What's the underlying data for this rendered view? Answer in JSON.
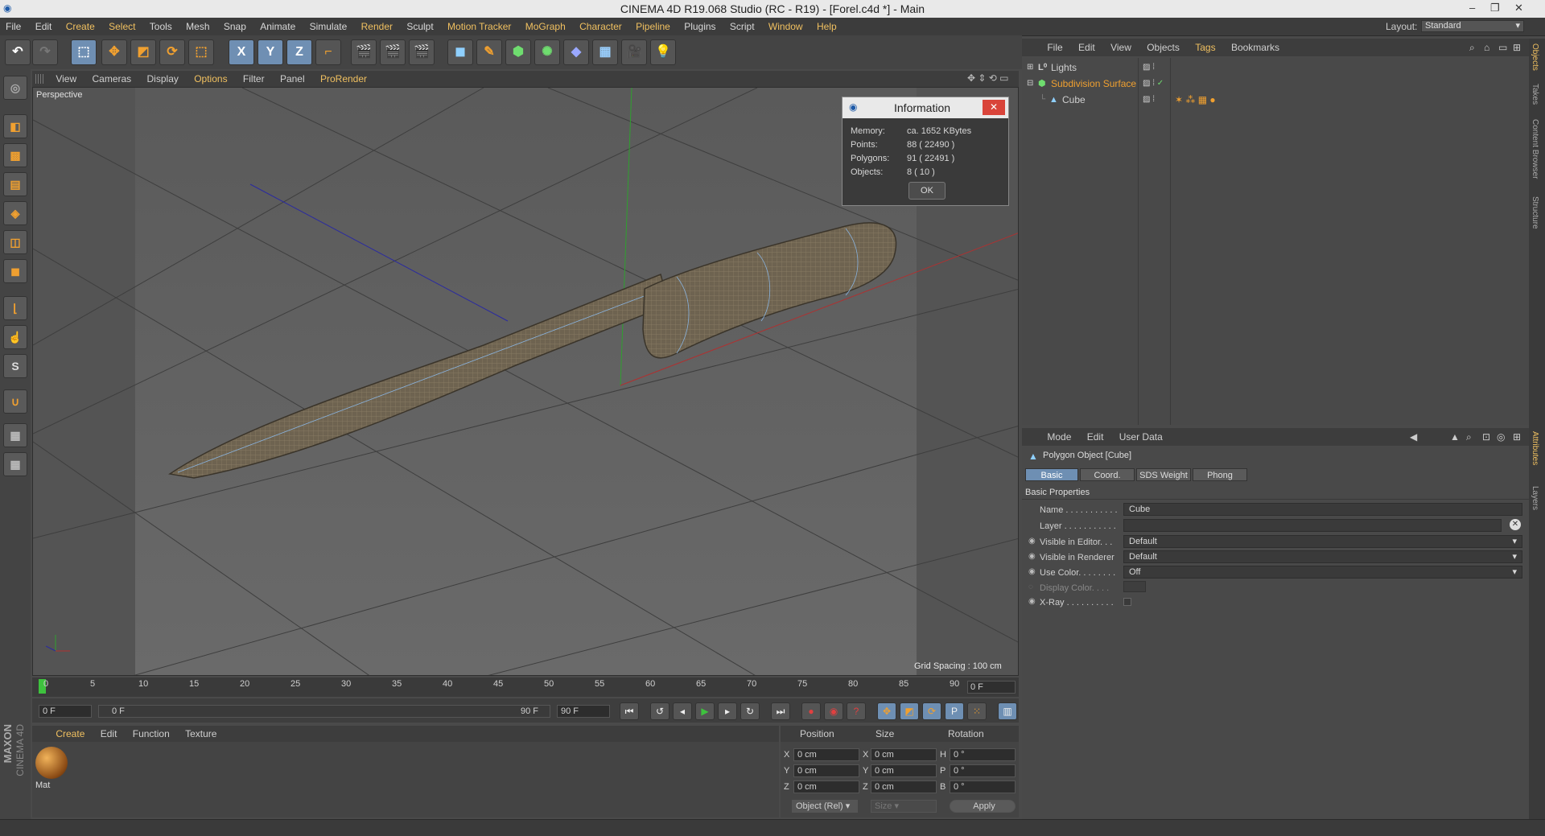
{
  "window": {
    "title": "CINEMA 4D R19.068 Studio (RC - R19) - [Forel.c4d *] - Main",
    "layout_label": "Layout:",
    "layout_value": "Standard"
  },
  "menubar": [
    "File",
    "Edit",
    "Create",
    "Select",
    "Tools",
    "Mesh",
    "Snap",
    "Animate",
    "Simulate",
    "Render",
    "Sculpt",
    "Motion Tracker",
    "MoGraph",
    "Character",
    "Pipeline",
    "Plugins",
    "Script",
    "Window",
    "Help"
  ],
  "toolbar": {
    "axis_x": "X",
    "axis_y": "Y",
    "axis_z": "Z"
  },
  "viewport": {
    "menu": [
      "View",
      "Cameras",
      "Display",
      "Options",
      "Filter",
      "Panel",
      "ProRender"
    ],
    "camera_label": "Perspective",
    "grid_spacing": "Grid Spacing : 100 cm"
  },
  "info_dialog": {
    "title": "Information",
    "rows": [
      {
        "label": "Memory:",
        "value": "ca. 1652 KBytes"
      },
      {
        "label": "Points:",
        "value": "88 ( 22490 )"
      },
      {
        "label": "Polygons:",
        "value": "91 ( 22491 )"
      },
      {
        "label": "Objects:",
        "value": "8 ( 10 )"
      }
    ],
    "ok_label": "OK"
  },
  "timeline": {
    "ticks": [
      "0",
      "5",
      "10",
      "15",
      "20",
      "25",
      "30",
      "35",
      "40",
      "45",
      "50",
      "55",
      "60",
      "65",
      "70",
      "75",
      "80",
      "85",
      "90"
    ],
    "current_frame": "0 F",
    "start_field": "0 F",
    "range_start": "0 F",
    "range_end": "90 F",
    "end_field": "90 F"
  },
  "material_manager": {
    "menu": [
      "Create",
      "Edit",
      "Function",
      "Texture"
    ],
    "materials": [
      {
        "name": "Mat"
      }
    ]
  },
  "coordinates": {
    "headers": {
      "position": "Position",
      "size": "Size",
      "rotation": "Rotation"
    },
    "rows": [
      {
        "axis": "X",
        "pos": "0 cm",
        "size_axis": "X",
        "size": "0 cm",
        "rot_axis": "H",
        "rot": "0 °"
      },
      {
        "axis": "Y",
        "pos": "0 cm",
        "size_axis": "Y",
        "size": "0 cm",
        "rot_axis": "P",
        "rot": "0 °"
      },
      {
        "axis": "Z",
        "pos": "0 cm",
        "size_axis": "Z",
        "size": "0 cm",
        "rot_axis": "B",
        "rot": "0 °"
      }
    ],
    "mode_select": "Object (Rel)",
    "size_select": "Size",
    "apply_label": "Apply"
  },
  "object_manager": {
    "menu": [
      "File",
      "Edit",
      "View",
      "Objects",
      "Tags",
      "Bookmarks"
    ],
    "objects": [
      {
        "name": "Lights",
        "color": "#d0d0d0"
      },
      {
        "name": "Subdivision Surface",
        "color": "#f0a030"
      },
      {
        "name": "Cube",
        "color": "#d0d0d0"
      }
    ]
  },
  "attribute_manager": {
    "menu": [
      "Mode",
      "Edit",
      "User Data"
    ],
    "object_title": "Polygon Object [Cube]",
    "tabs": [
      "Basic",
      "Coord.",
      "SDS Weight",
      "Phong"
    ],
    "section": "Basic Properties",
    "props": [
      {
        "label": "Name . . . . . . . . . . .",
        "value": "Cube"
      },
      {
        "label": "Layer . . . . . . . . . . .",
        "value": ""
      },
      {
        "label": "Visible in Editor. . .",
        "value": "Default"
      },
      {
        "label": "Visible in Renderer",
        "value": "Default"
      },
      {
        "label": "Use Color. . . . . . . .",
        "value": "Off"
      },
      {
        "label": "Display Color. . . .",
        "value": ""
      },
      {
        "label": "X-Ray . . . . . . . . . .",
        "value": ""
      }
    ]
  },
  "side_tabs": [
    "Objects",
    "Takes",
    "Content Browser",
    "Structure",
    "Attributes",
    "Layers"
  ],
  "brand": {
    "maxon": "MAXON",
    "product": "CINEMA 4D"
  },
  "colors": {
    "accent": "#f0c060",
    "selection": "#6e8fb3",
    "close": "#d9443a"
  }
}
